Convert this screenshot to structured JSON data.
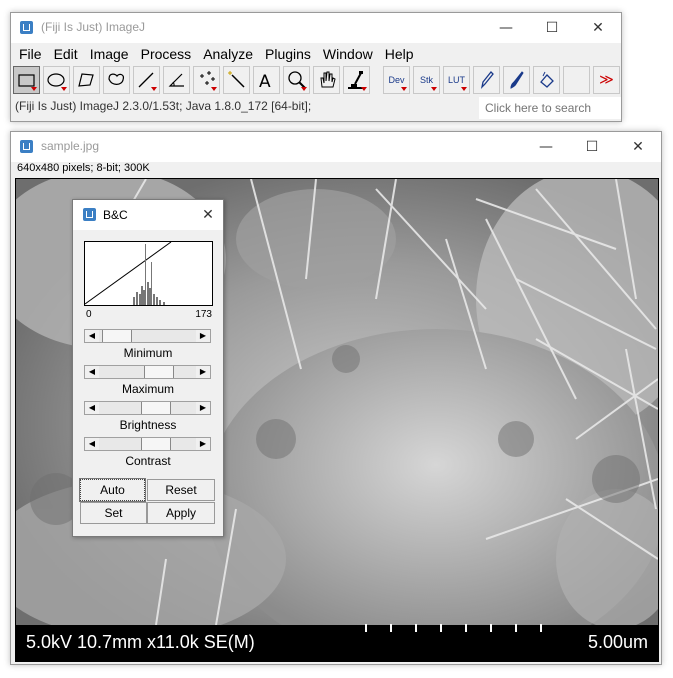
{
  "main_window": {
    "title": "(Fiji Is Just) ImageJ",
    "menu": [
      "File",
      "Edit",
      "Image",
      "Process",
      "Analyze",
      "Plugins",
      "Window",
      "Help"
    ],
    "toolbar": {
      "dev_label": "Dev",
      "stk_label": "Stk",
      "lut_label": "LUT",
      "more_icon": "≫"
    },
    "status": "(Fiji Is Just) ImageJ 2.3.0/1.53t; Java 1.8.0_172 [64-bit];",
    "search_placeholder": "Click here to search"
  },
  "image_window": {
    "title": "sample.jpg",
    "info": "640x480 pixels; 8-bit; 300K",
    "scalebar_left": "5.0kV 10.7mm x11.0k SE(M)",
    "scalebar_right": "5.00um"
  },
  "bc_dialog": {
    "title": "B&C",
    "hist_min": "0",
    "hist_max": "173",
    "sliders": [
      {
        "label": "Minimum",
        "value_fraction": 0.05
      },
      {
        "label": "Maximum",
        "value_fraction": 0.67
      },
      {
        "label": "Brightness",
        "value_fraction": 0.62
      },
      {
        "label": "Contrast",
        "value_fraction": 0.63
      }
    ],
    "buttons": {
      "auto": "Auto",
      "reset": "Reset",
      "set": "Set",
      "apply": "Apply"
    }
  },
  "colors": {
    "window_bg": "#f0f0f0",
    "title_icon": "#3b7fc4",
    "status_text": "#333333"
  }
}
